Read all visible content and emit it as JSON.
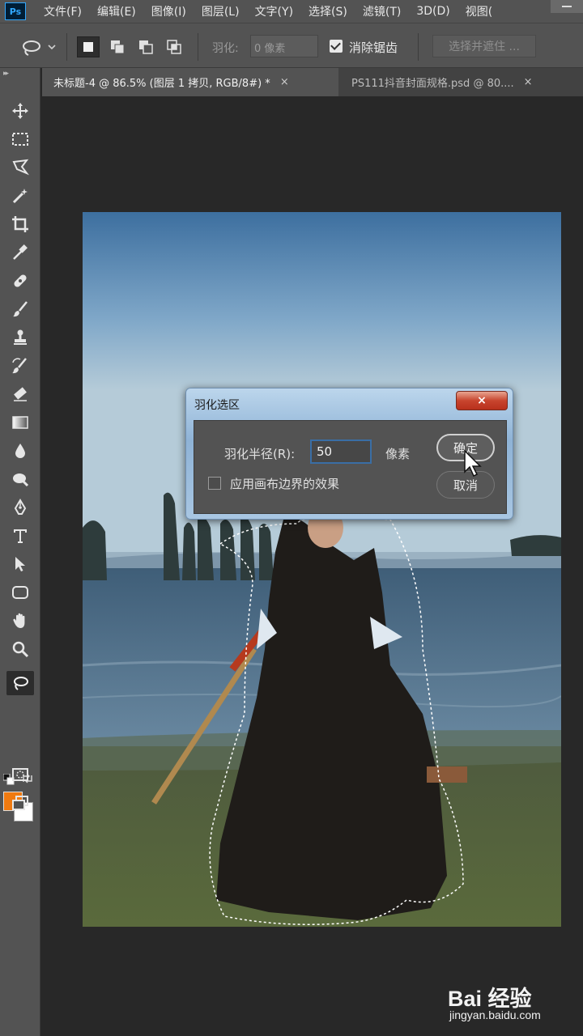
{
  "menu": {
    "logo": "Ps",
    "items": [
      "文件(F)",
      "编辑(E)",
      "图像(I)",
      "图层(L)",
      "文字(Y)",
      "选择(S)",
      "滤镜(T)",
      "3D(D)",
      "视图("
    ]
  },
  "options": {
    "feather_label": "羽化:",
    "feather_placeholder": "0 像素",
    "antialias_label": "消除锯齿",
    "antialias_checked": true,
    "select_mask_label": "选择并遮住 ..."
  },
  "tabs": [
    {
      "label": "未标题-4 @ 86.5% (图层 1 拷贝, RGB/8#) *",
      "close": "×",
      "active": true
    },
    {
      "label": "PS111抖音封面规格.psd @ 80....",
      "close": "×",
      "active": false
    }
  ],
  "toolbar": {
    "selected_tool": "lasso",
    "foreground_color": "#f07a10",
    "background_color": "#ffffff"
  },
  "dialog": {
    "title": "羽化选区",
    "close": "×",
    "radius_label": "羽化半径(R):",
    "radius_value": "50",
    "radius_unit": "像素",
    "apply_canvas_label": "应用画布边界的效果",
    "apply_canvas_checked": false,
    "ok_label": "确定",
    "cancel_label": "取消"
  },
  "watermark": {
    "brand": "Bai 经验",
    "url": "jingyan.baidu.com"
  }
}
